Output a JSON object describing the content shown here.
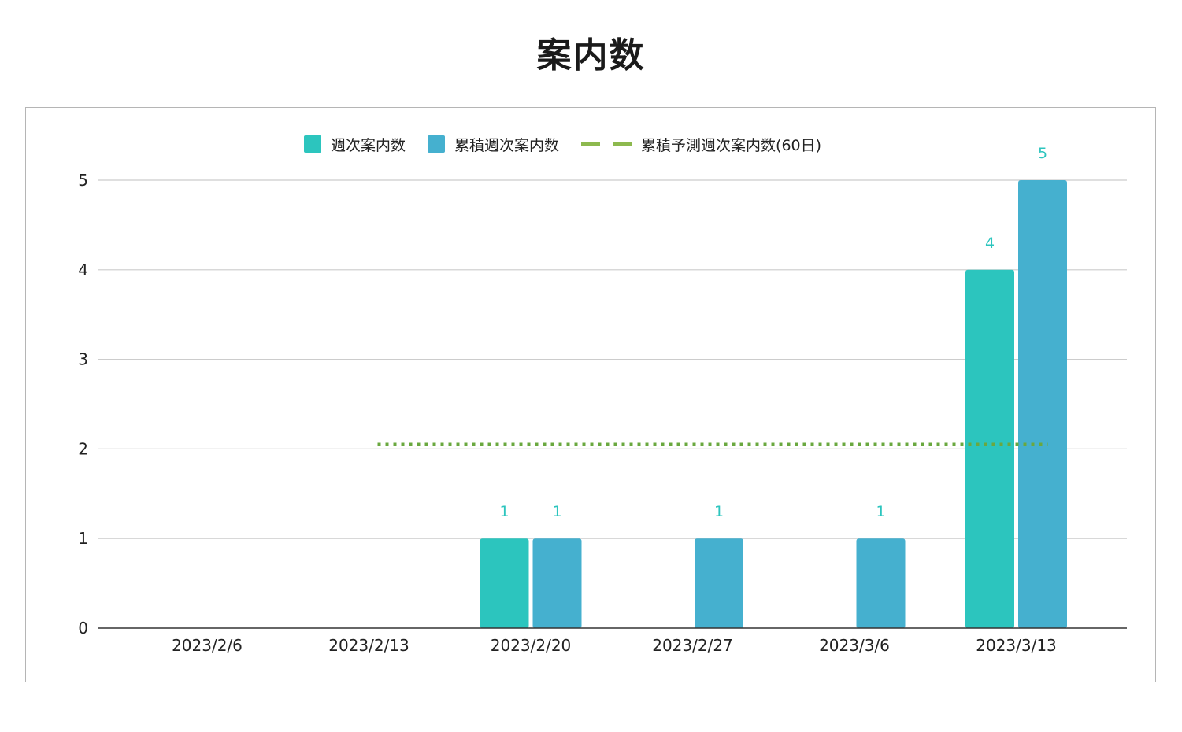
{
  "title": "案内数",
  "colors": {
    "weekly": "#2cc5be",
    "cumulative": "#45b0cf",
    "forecast": "#6aa83f",
    "grid": "#cccccc",
    "axis": "#333333",
    "label": "#2cc5be"
  },
  "legend": {
    "weekly": "週次案内数",
    "cumulative": "累積週次案内数",
    "forecast": "累積予測週次案内数(60日)"
  },
  "chart_data": {
    "type": "bar",
    "title": "案内数",
    "categories": [
      "2023/2/6",
      "2023/2/13",
      "2023/2/20",
      "2023/2/27",
      "2023/3/6",
      "2023/3/13"
    ],
    "series": [
      {
        "name": "週次案内数",
        "values": [
          0,
          0,
          1,
          0,
          0,
          4
        ]
      },
      {
        "name": "累積週次案内数",
        "values": [
          0,
          0,
          1,
          1,
          1,
          5
        ]
      }
    ],
    "forecast_line": {
      "name": "累積予測週次案内数(60日)",
      "value": 2.05,
      "from_category": "2023/2/13",
      "to_category": "2023/3/13",
      "style": "dotted"
    },
    "yticks": [
      0,
      1,
      2,
      3,
      4,
      5
    ],
    "ylim": [
      0,
      5
    ],
    "grid": true,
    "legend_position": "top"
  }
}
